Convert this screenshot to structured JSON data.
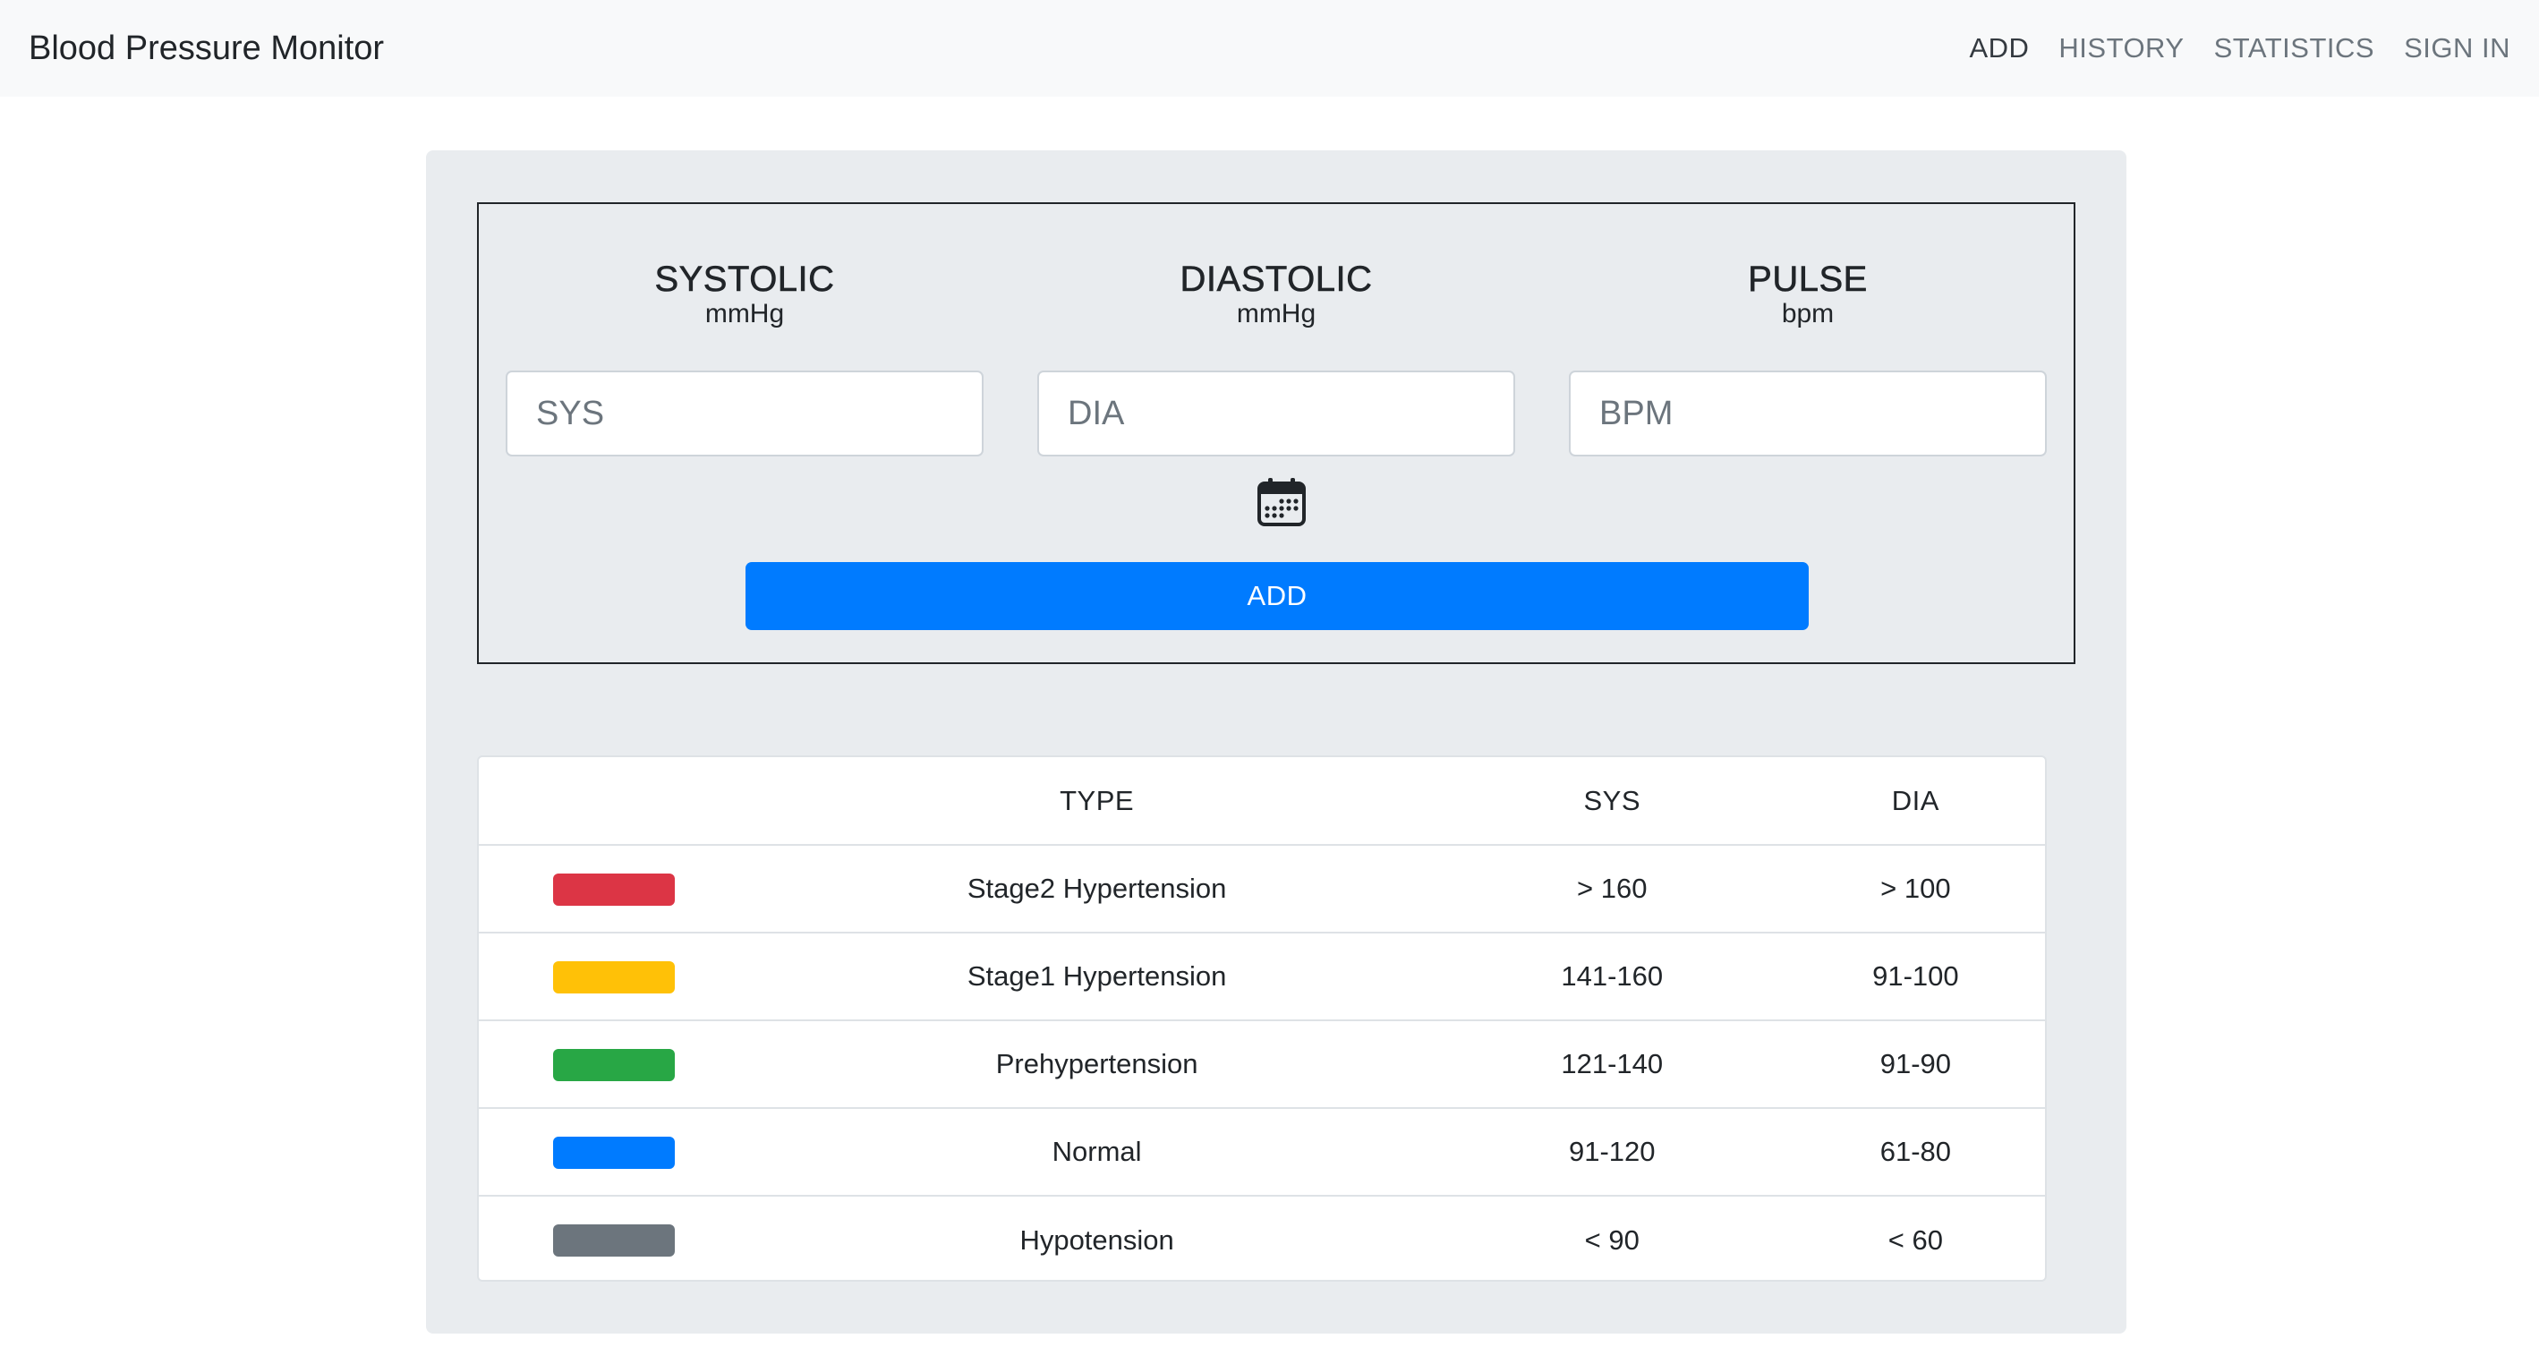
{
  "app": {
    "title": "Blood Pressure Monitor"
  },
  "nav": {
    "items": [
      {
        "label": "ADD",
        "active": true
      },
      {
        "label": "HISTORY",
        "active": false
      },
      {
        "label": "STATISTICS",
        "active": false
      },
      {
        "label": "SIGN IN",
        "active": false
      }
    ]
  },
  "form": {
    "systolic": {
      "title": "SYSTOLIC",
      "unit": "mmHg",
      "placeholder": "SYS",
      "value": ""
    },
    "diastolic": {
      "title": "DIASTOLIC",
      "unit": "mmHg",
      "placeholder": "DIA",
      "value": ""
    },
    "pulse": {
      "title": "PULSE",
      "unit": "bpm",
      "placeholder": "BPM",
      "value": ""
    },
    "calendar_icon": "calendar-icon",
    "submit_label": "ADD"
  },
  "legend": {
    "headers": {
      "swatch": "",
      "type": "TYPE",
      "sys": "SYS",
      "dia": "DIA"
    },
    "rows": [
      {
        "color": "#dc3545",
        "type": "Stage2 Hypertension",
        "sys": "> 160",
        "dia": "> 100"
      },
      {
        "color": "#ffc107",
        "type": "Stage1 Hypertension",
        "sys": "141-160",
        "dia": "91-100"
      },
      {
        "color": "#28a745",
        "type": "Prehypertension",
        "sys": "121-140",
        "dia": "91-90"
      },
      {
        "color": "#007bff",
        "type": "Normal",
        "sys": "91-120",
        "dia": "61-80"
      },
      {
        "color": "#6c757d",
        "type": "Hypotension",
        "sys": "< 90",
        "dia": "< 60"
      }
    ]
  },
  "colors": {
    "primary": "#007bff",
    "navbar_bg": "#f8f9fa",
    "panel_bg": "#e9ecef"
  }
}
